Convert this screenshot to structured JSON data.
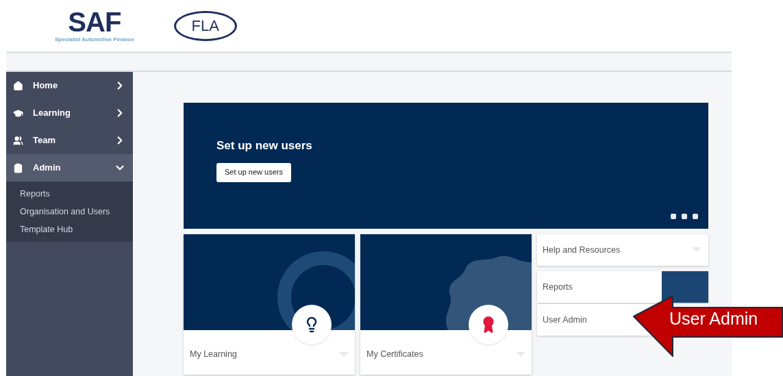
{
  "header": {
    "saf_logo": {
      "letters": "SAF",
      "tagline": "Specialist Automotive Finance"
    },
    "fla_logo": {
      "letters": "FLA"
    }
  },
  "sidebar": {
    "items": [
      {
        "label": "Home",
        "kind": "home",
        "expanded": false
      },
      {
        "label": "Learning",
        "kind": "learning",
        "expanded": false
      },
      {
        "label": "Team",
        "kind": "team",
        "expanded": false
      },
      {
        "label": "Admin",
        "kind": "admin",
        "expanded": true,
        "children": [
          {
            "label": "Reports"
          },
          {
            "label": "Organisation and Users"
          },
          {
            "label": "Template Hub"
          }
        ]
      }
    ]
  },
  "banner": {
    "title": "Set up new users",
    "button": "Set up new users"
  },
  "cards": [
    {
      "kind": "learning",
      "title": "My Learning"
    },
    {
      "kind": "certificates",
      "title": "My Certificates"
    }
  ],
  "tiles": [
    {
      "title": "Help and Resources",
      "has_image": false
    },
    {
      "title": "Reports",
      "has_image": true
    },
    {
      "title": "User Admin",
      "has_image": false
    }
  ],
  "callout": {
    "text": "User Admin"
  }
}
